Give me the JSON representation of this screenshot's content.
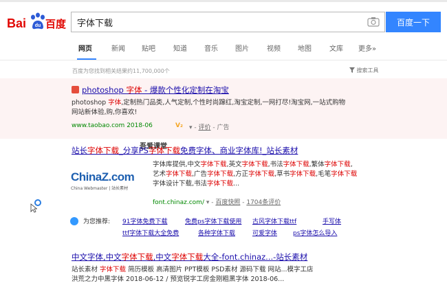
{
  "logo": {
    "bai": "Bai",
    "du": "du",
    "cn": "百度"
  },
  "search": {
    "value": "字体下载",
    "button": "百度一下"
  },
  "tabs": [
    "网页",
    "新闻",
    "贴吧",
    "知道",
    "音乐",
    "图片",
    "视频",
    "地图",
    "文库",
    "更多»"
  ],
  "result_count": "百度为您找到相关结果约11,700,000个",
  "search_tools": "搜索工具",
  "ad": {
    "title_a": "photoshop ",
    "title_b": "字体",
    "title_c": " - 爆款个性化定制在淘宝",
    "snippet_line1_a": "photoshop ",
    "snippet_line1_b": "字体",
    "snippet_line1_c": ",定制热门品类,人气定制,个性时尚蹿红,淘宝定制,一网打尽!淘宝网,一站式购物",
    "snippet_line2": "网站新体验,购,你喜欢!",
    "url": "www.taobao.com",
    "date": "2018-06",
    "v_tag": "V₂",
    "rating": "评价",
    "ad_label": "广告"
  },
  "overlay": "吾爱课堂",
  "result1": {
    "title_a": "站长",
    "title_b": "字体下载",
    "title_c": "_分享PS",
    "title_d": "字体下载",
    "title_e": "免费字体、商业字体库!_站长素材",
    "snip": [
      [
        "字体库提供,中文",
        "字体下载",
        ",英文",
        "字体下载",
        ",书法",
        "字体下载",
        ",繁体",
        "字体下载",
        ","
      ],
      [
        "艺术",
        "字体下载",
        ",广告",
        "字体下载",
        ",方正",
        "字体下载",
        ",草书",
        "字体下载",
        ",毛笔",
        "字体下载",
        ""
      ],
      [
        "字体设计下载,书法",
        "字体下载",
        "..."
      ]
    ],
    "url": "font.chinaz.com/",
    "snapshot": "百度快照",
    "reviews": "1704条评价",
    "logo_main": "ChinaZ.com",
    "logo_sub": "China Webmaster | 站长素材"
  },
  "recommend": {
    "label": "为您推荐:",
    "links": [
      "91字体免费下载",
      "免费ps字体下载使用",
      "古风字体下载ttf",
      "手写体",
      "ttf字体下载大全免费",
      "各种字体下载",
      "可爱字体",
      "ps字体怎么导入"
    ]
  },
  "result2": {
    "title_a": "中文字体,中文",
    "title_b": "字体下载",
    "title_c": ",中文",
    "title_d": "字体下载",
    "title_e": "大全-font.chinaz...-站长素材",
    "snip1_a": "站长素材 ",
    "snip1_b": "字体下载",
    "snip1_c": " 简历模板 高清图片 PPT模板 PSD素材 源码下载 网站...模字工店",
    "snip2": "洪荒之力中黑字体 2018-06-12 / 预览锐字工房金刚粗黑字体 2018-06..."
  },
  "colors": {
    "brand_blue": "#3385ff",
    "brand_red": "#e10602",
    "link": "#1a0dab",
    "url_green": "#008000",
    "highlight": "#dd0000"
  }
}
